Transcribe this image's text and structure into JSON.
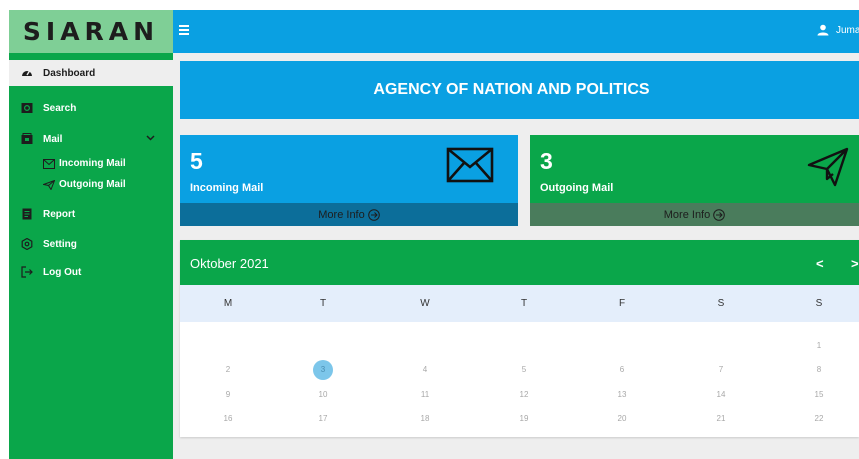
{
  "app": {
    "logo": "SIARAN"
  },
  "sidebar": {
    "items": [
      {
        "label": "Dashboard"
      },
      {
        "label": "Search"
      },
      {
        "label": "Mail"
      },
      {
        "label": "Incoming Mail"
      },
      {
        "label": "Outgoing Mail"
      },
      {
        "label": "Report"
      },
      {
        "label": "Setting"
      },
      {
        "label": "Log Out"
      }
    ]
  },
  "topbar": {
    "user_name": "Jumadi"
  },
  "banner": {
    "title": "AGENCY OF NATION AND POLITICS"
  },
  "cards": {
    "incoming": {
      "count": "5",
      "label": "Incoming Mail",
      "more": "More Info"
    },
    "outgoing": {
      "count": "3",
      "label": "Outgoing Mail",
      "more": "More Info"
    }
  },
  "calendar": {
    "month": "Oktober 2021",
    "prev": "<",
    "next": ">",
    "weekdays": [
      "M",
      "T",
      "W",
      "T",
      "F",
      "S",
      "S"
    ],
    "weeks": [
      [
        "",
        "",
        "",
        "",
        "",
        "",
        "1"
      ],
      [
        "2",
        "3",
        "4",
        "5",
        "6",
        "7",
        "8"
      ],
      [
        "9",
        "10",
        "11",
        "12",
        "13",
        "14",
        "15"
      ],
      [
        "16",
        "17",
        "18",
        "19",
        "20",
        "21",
        "22"
      ]
    ],
    "today": "3"
  },
  "colors": {
    "sidebar": "#0aa64a",
    "topbar": "#0aa0e2",
    "logo_bg": "#7fcf96",
    "incoming_footer": "#0c6e9a",
    "outgoing_footer": "#4a7c5c",
    "calendar_days_bg": "#e4eefb",
    "today_highlight": "#7cc6ea"
  },
  "icons": {
    "dashboard": "dashboard-icon",
    "search": "search-icon",
    "mail": "mail-icon",
    "incoming": "envelope-icon",
    "outgoing": "paper-plane-icon",
    "report": "report-icon",
    "setting": "gear-icon",
    "logout": "logout-icon",
    "user": "user-icon",
    "menu": "hamburger-icon",
    "more_info": "arrow-circle-right-icon"
  }
}
